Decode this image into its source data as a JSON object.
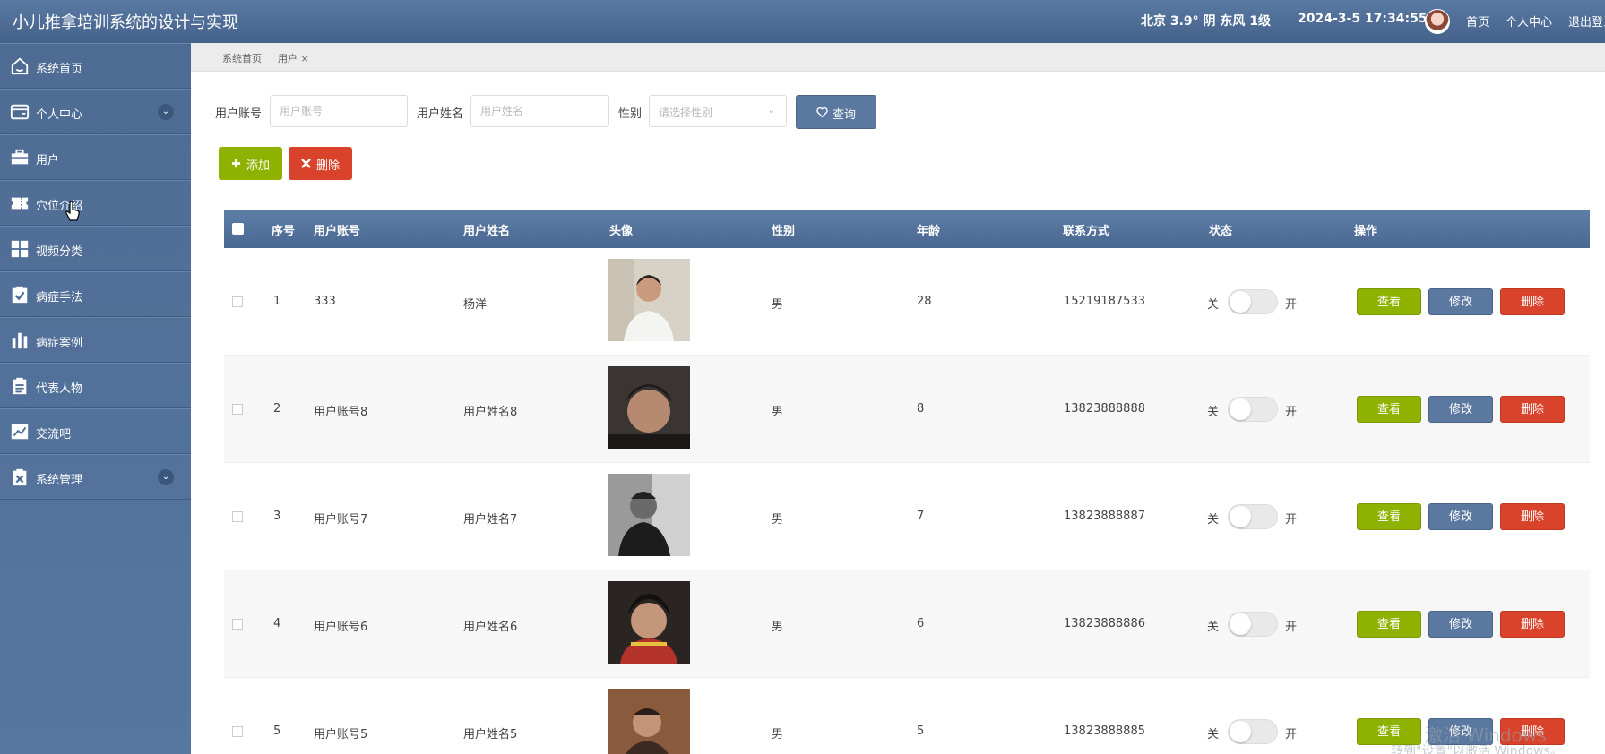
{
  "app": {
    "title": "小儿推拿培训系统的设计与实现",
    "weather": "北京  3.9°  阴  东风  1级",
    "datetime": "2024-3-5 17:34:55",
    "nav": [
      "首页",
      "个人中心",
      "退出登录"
    ]
  },
  "sidebar": {
    "items": [
      {
        "label": "系统首页",
        "icon": "home-icon",
        "chevron": false
      },
      {
        "label": "个人中心",
        "icon": "wallet-icon",
        "chevron": true
      },
      {
        "label": "用户",
        "icon": "briefcase-icon",
        "chevron": false
      },
      {
        "label": "穴位介绍",
        "icon": "ticket-icon",
        "chevron": false
      },
      {
        "label": "视频分类",
        "icon": "grid-icon",
        "chevron": false
      },
      {
        "label": "病症手法",
        "icon": "checklist-icon",
        "chevron": false
      },
      {
        "label": "病症案例",
        "icon": "bar-chart-icon",
        "chevron": false
      },
      {
        "label": "代表人物",
        "icon": "clipboard-icon",
        "chevron": false
      },
      {
        "label": "交流吧",
        "icon": "line-chart-icon",
        "chevron": false
      },
      {
        "label": "系统管理",
        "icon": "x-box-icon",
        "chevron": true
      }
    ]
  },
  "breadcrumb": {
    "home": "系统首页",
    "current": "用户 ×"
  },
  "search": {
    "account_label": "用户账号",
    "account_placeholder": "用户账号",
    "name_label": "用户姓名",
    "name_placeholder": "用户姓名",
    "gender_label": "性别",
    "gender_placeholder": "请选择性别",
    "query_button": "查询"
  },
  "actions": {
    "add": "添加",
    "delete": "删除"
  },
  "table": {
    "headers": [
      "序号",
      "用户账号",
      "用户姓名",
      "头像",
      "性别",
      "年龄",
      "联系方式",
      "状态",
      "操作"
    ],
    "toggle_off": "关",
    "toggle_on": "开",
    "view": "查看",
    "edit": "修改",
    "delete": "删除",
    "rows": [
      {
        "index": "1",
        "account": "333",
        "name": "杨洋",
        "gender": "男",
        "age": "28",
        "phone": "15219187533",
        "status_on": false
      },
      {
        "index": "2",
        "account": "用户账号8",
        "name": "用户姓名8",
        "gender": "男",
        "age": "8",
        "phone": "13823888888",
        "status_on": false
      },
      {
        "index": "3",
        "account": "用户账号7",
        "name": "用户姓名7",
        "gender": "男",
        "age": "7",
        "phone": "13823888887",
        "status_on": false
      },
      {
        "index": "4",
        "account": "用户账号6",
        "name": "用户姓名6",
        "gender": "男",
        "age": "6",
        "phone": "13823888886",
        "status_on": false
      },
      {
        "index": "5",
        "account": "用户账号5",
        "name": "用户姓名5",
        "gender": "男",
        "age": "5",
        "phone": "13823888885",
        "status_on": false
      }
    ]
  },
  "watermark": {
    "line1": "激活 Windows",
    "line2": "转到\"设置\"以激活 Windows。"
  }
}
